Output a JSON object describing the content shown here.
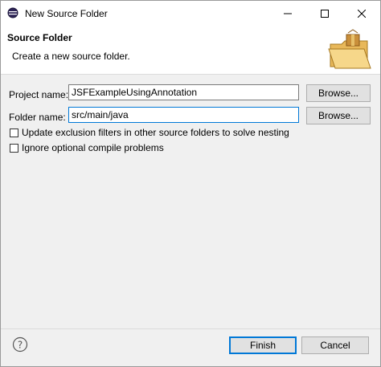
{
  "window": {
    "title": "New Source Folder"
  },
  "header": {
    "title": "Source Folder",
    "description": "Create a new source folder."
  },
  "form": {
    "project_label": "Project name:",
    "project_value": "JSFExampleUsingAnnotation",
    "folder_label": "Folder name:",
    "folder_value": "src/main/java",
    "browse_label": "Browse...",
    "options": [
      {
        "label": "Update exclusion filters in other source folders to solve nesting",
        "checked": false
      },
      {
        "label": "Ignore optional compile problems",
        "checked": false
      }
    ]
  },
  "footer": {
    "finish_label": "Finish",
    "cancel_label": "Cancel"
  },
  "icons": {
    "app": "eclipse-icon",
    "header": "source-folder-wizard-icon",
    "help": "help-icon"
  },
  "colors": {
    "focus_accent": "#0078d7"
  }
}
